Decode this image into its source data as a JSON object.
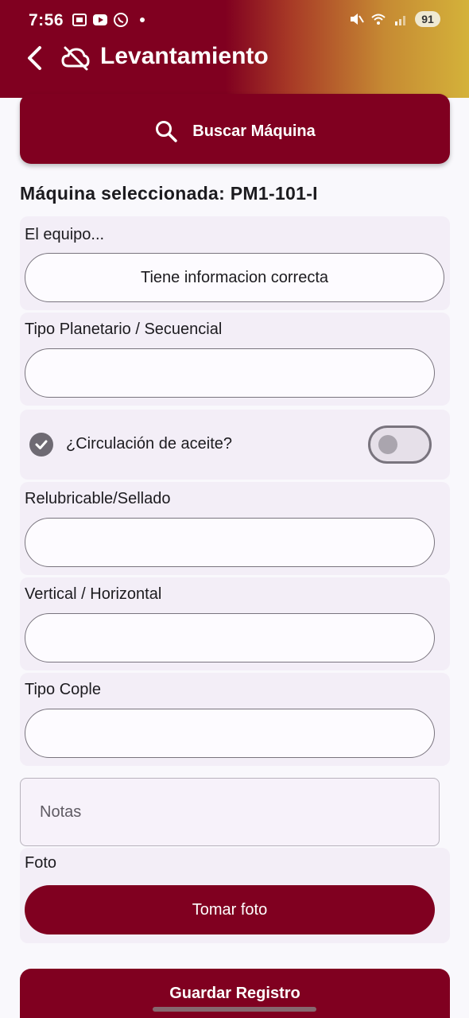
{
  "status_bar": {
    "time": "7:56",
    "battery": "91"
  },
  "header": {
    "title": "Levantamiento"
  },
  "search": {
    "label": "Buscar Máquina"
  },
  "machine": {
    "selected_text": "Máquina seleccionada: PM1-101-I"
  },
  "fields": {
    "equipo": {
      "label": "El equipo...",
      "value": "Tiene informacion correcta"
    },
    "tipo_planetario": {
      "label": "Tipo Planetario / Secuencial",
      "value": ""
    },
    "circulacion": {
      "label": "¿Circulación de aceite?",
      "checked": false
    },
    "relubricable": {
      "label": "Relubricable/Sellado",
      "value": ""
    },
    "vertical": {
      "label": "Vertical / Horizontal",
      "value": ""
    },
    "tipo_cople": {
      "label": "Tipo Cople",
      "value": ""
    }
  },
  "notes": {
    "placeholder": "Notas"
  },
  "photo": {
    "label": "Foto",
    "button": "Tomar foto"
  },
  "save": {
    "label": "Guardar Registro"
  },
  "colors": {
    "primary": "#800020",
    "accent_gold": "#d4b23a",
    "card_bg": "#f3eef7"
  }
}
